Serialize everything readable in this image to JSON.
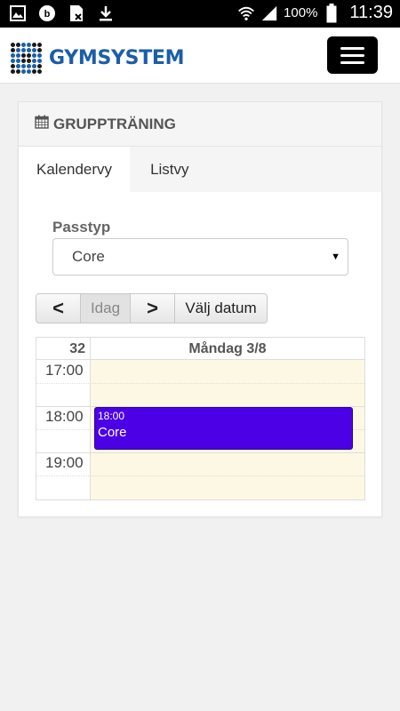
{
  "statusbar": {
    "battery": "100%",
    "time": "11:39",
    "icons": [
      "gallery-icon",
      "notification-b-icon",
      "sim-icon",
      "download-icon",
      "wifi-icon",
      "signal-icon",
      "battery-icon"
    ]
  },
  "header": {
    "logo_text": "GYMSYSTEM",
    "menu_icon": "hamburger-icon"
  },
  "panel": {
    "title": "GRUPPTRÄNING",
    "title_icon": "calendar-icon",
    "tabs": [
      {
        "label": "Kalendervy",
        "active": true
      },
      {
        "label": "Listvy",
        "active": false
      }
    ],
    "passtyp_label": "Passtyp",
    "passtyp_value": "Core"
  },
  "nav": {
    "prev": "<",
    "today": "Idag",
    "next": ">",
    "pick": "Välj datum"
  },
  "calendar": {
    "week": "32",
    "day": "Måndag 3/8",
    "times": [
      "17:00",
      "18:00",
      "19:00"
    ],
    "event": {
      "time": "18:00",
      "name": "Core",
      "color": "#4b00e6"
    },
    "day_bg": "#fcf8e3"
  },
  "colors": {
    "brand": "#1b5ea8",
    "accent": "#4b00e6"
  }
}
